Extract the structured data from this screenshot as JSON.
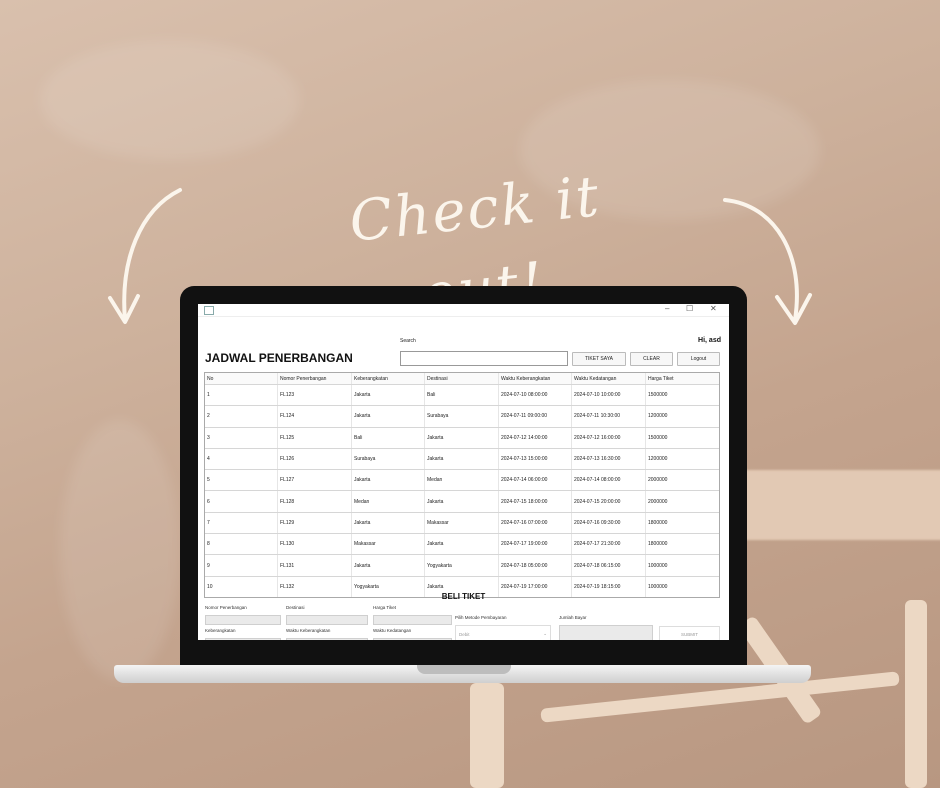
{
  "poster": {
    "headline": "Check it out!"
  },
  "window": {
    "minimize_glyph": "–",
    "maximize_glyph": "☐",
    "close_glyph": "✕"
  },
  "app": {
    "title": "JADWAL PENERBANGAN",
    "search_label": "Search",
    "search_value": "",
    "buttons": {
      "tiket_saya": "TIKET SAYA",
      "clear": "CLEAR",
      "logout": "Logout"
    },
    "greeting": "Hi, asd"
  },
  "table": {
    "columns": [
      "No",
      "Nomor Penerbangan",
      "Keberangkatan",
      "Destinasi",
      "Waktu Keberangkatan",
      "Waktu Kedatangan",
      "Harga Tiket"
    ],
    "rows": [
      [
        "1",
        "FL123",
        "Jakarta",
        "Bali",
        "2024-07-10 08:00:00",
        "2024-07-10 10:00:00",
        "1500000"
      ],
      [
        "2",
        "FL124",
        "Jakarta",
        "Surabaya",
        "2024-07-11 09:00:00",
        "2024-07-11 10:30:00",
        "1200000"
      ],
      [
        "3",
        "FL125",
        "Bali",
        "Jakarta",
        "2024-07-12 14:00:00",
        "2024-07-12 16:00:00",
        "1500000"
      ],
      [
        "4",
        "FL126",
        "Surabaya",
        "Jakarta",
        "2024-07-13 15:00:00",
        "2024-07-13 16:30:00",
        "1200000"
      ],
      [
        "5",
        "FL127",
        "Jakarta",
        "Medan",
        "2024-07-14 06:00:00",
        "2024-07-14 08:00:00",
        "2000000"
      ],
      [
        "6",
        "FL128",
        "Medan",
        "Jakarta",
        "2024-07-15 18:00:00",
        "2024-07-15 20:00:00",
        "2000000"
      ],
      [
        "7",
        "FL129",
        "Jakarta",
        "Makassar",
        "2024-07-16 07:00:00",
        "2024-07-16 09:30:00",
        "1800000"
      ],
      [
        "8",
        "FL130",
        "Makassar",
        "Jakarta",
        "2024-07-17 19:00:00",
        "2024-07-17 21:30:00",
        "1800000"
      ],
      [
        "9",
        "FL131",
        "Jakarta",
        "Yogyakarta",
        "2024-07-18 05:00:00",
        "2024-07-18 06:15:00",
        "1000000"
      ],
      [
        "10",
        "FL132",
        "Yogyakarta",
        "Jakarta",
        "2024-07-19 17:00:00",
        "2024-07-19 18:15:00",
        "1000000"
      ]
    ]
  },
  "form": {
    "title": "BELI TIKET",
    "nomor_label": "Nomor Penerbangan",
    "destinasi_label": "Destinasi",
    "harga_label": "Harga Tiket",
    "keberangkatan_label": "Keberangkatan",
    "waktu_keberangkatan_label": "Waktu Keberangkatan",
    "waktu_kedatangan_label": "Waktu Kedatangan",
    "metode_label": "Pilih Metode Pembayaran",
    "metode_value": "Debit",
    "jumlah_label": "Jumlah Bayar",
    "submit_label": "SUBMIT"
  }
}
